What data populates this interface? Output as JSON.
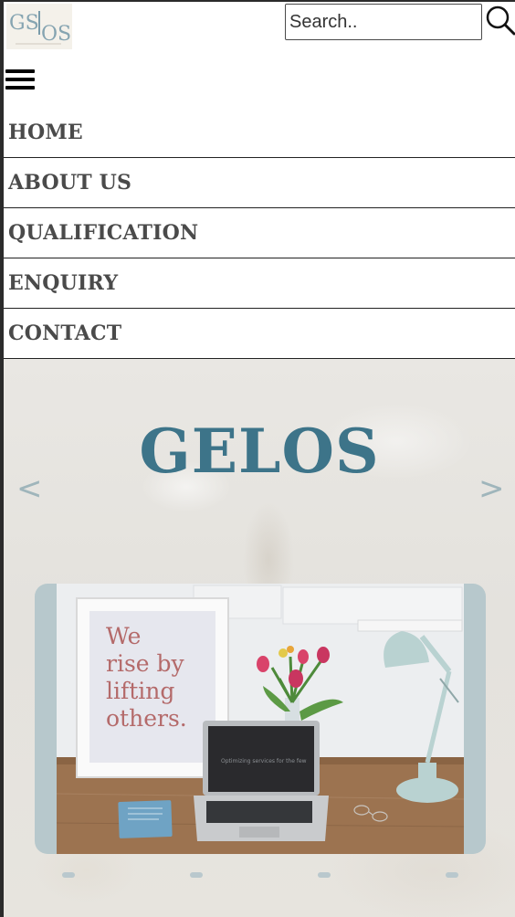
{
  "header": {
    "logo_alt": "GSIOS logo",
    "search": {
      "placeholder": "Search.."
    }
  },
  "nav": {
    "items": [
      {
        "label": "HOME"
      },
      {
        "label": "ABOUT US"
      },
      {
        "label": "QUALIFICATION"
      },
      {
        "label": "ENQUIRY"
      },
      {
        "label": "CONTACT"
      }
    ]
  },
  "hero": {
    "title": "GELOS",
    "carousel": {
      "prev_label": "<",
      "next_label": ">",
      "slide": {
        "poster_text": [
          "We",
          "rise by",
          "lifting",
          "others."
        ],
        "laptop_screen_text": "Optimizing services for the few"
      },
      "slide_count": 4
    }
  },
  "colors": {
    "accent": "#3d7489",
    "nav_text": "#4a4a4a",
    "carousel_bg": "#b7c8cc"
  },
  "icons": [
    "search-icon",
    "hamburger-icon",
    "chevron-left-icon",
    "chevron-right-icon"
  ]
}
